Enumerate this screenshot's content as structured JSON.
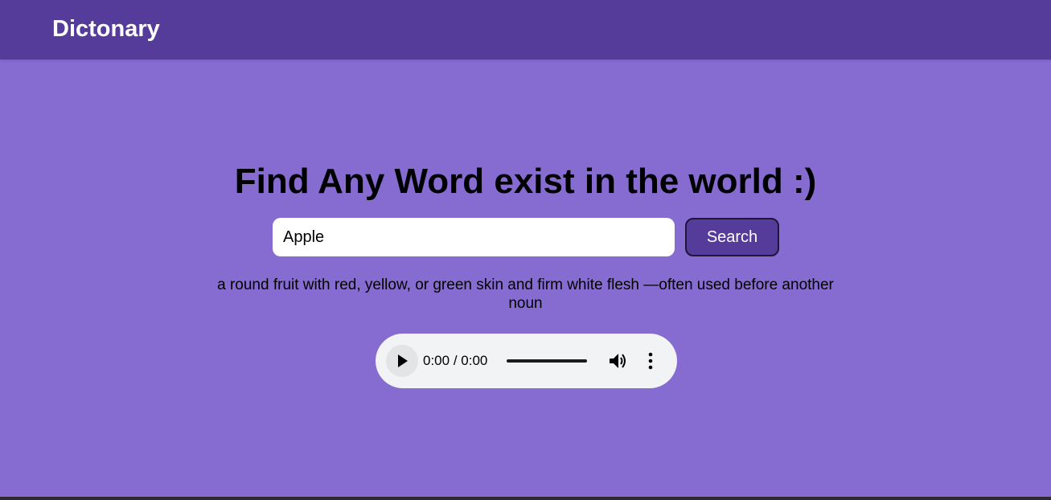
{
  "navbar": {
    "brand": "Dictonary"
  },
  "main": {
    "headline": "Find Any Word exist in the world :)",
    "search": {
      "value": "Apple",
      "placeholder": "",
      "button_label": "Search"
    },
    "definition": "a round fruit with red, yellow, or green skin and firm white flesh —often used before another noun"
  },
  "audio": {
    "current_time": "0:00",
    "separator": " / ",
    "duration": "0:00",
    "progress": 0,
    "icons": {
      "play": "play-icon",
      "volume": "volume-icon",
      "more": "more-vert-icon"
    }
  },
  "colors": {
    "background": "#866bd1",
    "navbar": "#553c9a",
    "button": "#553c9a",
    "player": "#f1f3f4"
  }
}
